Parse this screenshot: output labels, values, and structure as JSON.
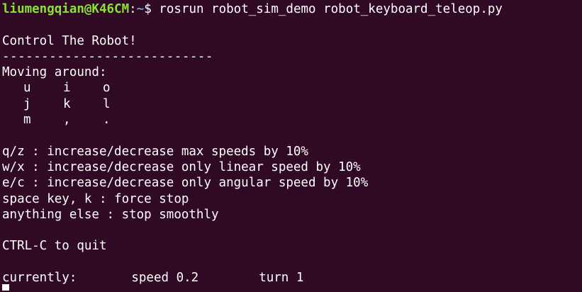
{
  "prompt": {
    "user_host": "liumengqian@K46CM",
    "separator": ":",
    "path": "~",
    "symbol": "$",
    "command": " rosrun robot_sim_demo robot_keyboard_teleop.py"
  },
  "output": {
    "title": "Control The Robot!",
    "divider": "---------------------------",
    "moving_header": "Moving around:",
    "key_rows": [
      [
        "u",
        "i",
        "o"
      ],
      [
        "j",
        "k",
        "l"
      ],
      [
        "m",
        ",",
        "."
      ]
    ],
    "help": [
      "q/z : increase/decrease max speeds by 10%",
      "w/x : increase/decrease only linear speed by 10%",
      "e/c : increase/decrease only angular speed by 10%",
      "space key, k : force stop",
      "anything else : stop smoothly"
    ],
    "quit": "CTRL-C to quit",
    "status_label": "currently:",
    "speed_text": "speed 0.2",
    "turn_text": "turn 1"
  },
  "colors": {
    "background": "#300a24",
    "user_host": "#8ae234",
    "path": "#729fcf",
    "text": "#ffffff"
  }
}
